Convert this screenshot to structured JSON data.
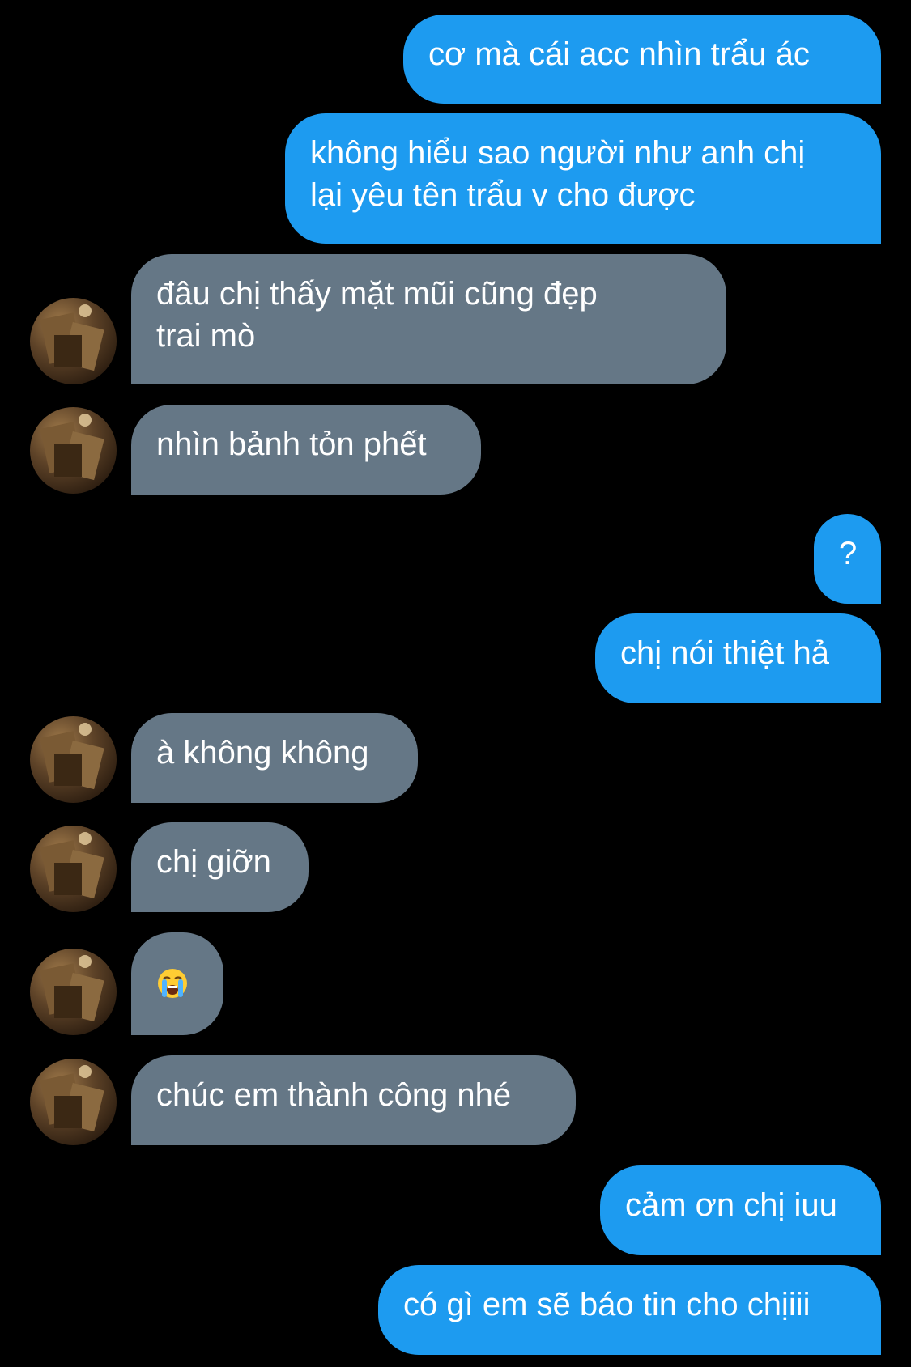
{
  "conversation": {
    "messages": [
      {
        "from": "me",
        "text": "cơ mà cái acc nhìn trẩu ác"
      },
      {
        "from": "me",
        "line1": "không hiểu sao người như anh chị",
        "line2": "lại yêu tên trẩu v cho được"
      },
      {
        "from": "them",
        "line1": "đâu chị thấy mặt mũi cũng đẹp",
        "line2": "trai mò"
      },
      {
        "from": "them",
        "text": "nhìn bảnh tỏn phết"
      },
      {
        "from": "me",
        "text": "?"
      },
      {
        "from": "me",
        "text": "chị nói thiệt hả"
      },
      {
        "from": "them",
        "text": "à không không"
      },
      {
        "from": "them",
        "text": "chị giỡn"
      },
      {
        "from": "them",
        "emoji": "loudly-crying-face"
      },
      {
        "from": "them",
        "text": "chúc em thành công nhé"
      },
      {
        "from": "me",
        "text": "cảm ơn chị iuu"
      },
      {
        "from": "me",
        "text": "có gì em sẽ báo tin cho chịiii"
      }
    ]
  },
  "colors": {
    "background": "#000000",
    "sent_bubble": "#1d9bf0",
    "received_bubble": "#657786",
    "text": "#ffffff"
  },
  "icons": {
    "avatar": "contact-avatar-photo",
    "emoji": "loudly-crying-face-emoji"
  }
}
